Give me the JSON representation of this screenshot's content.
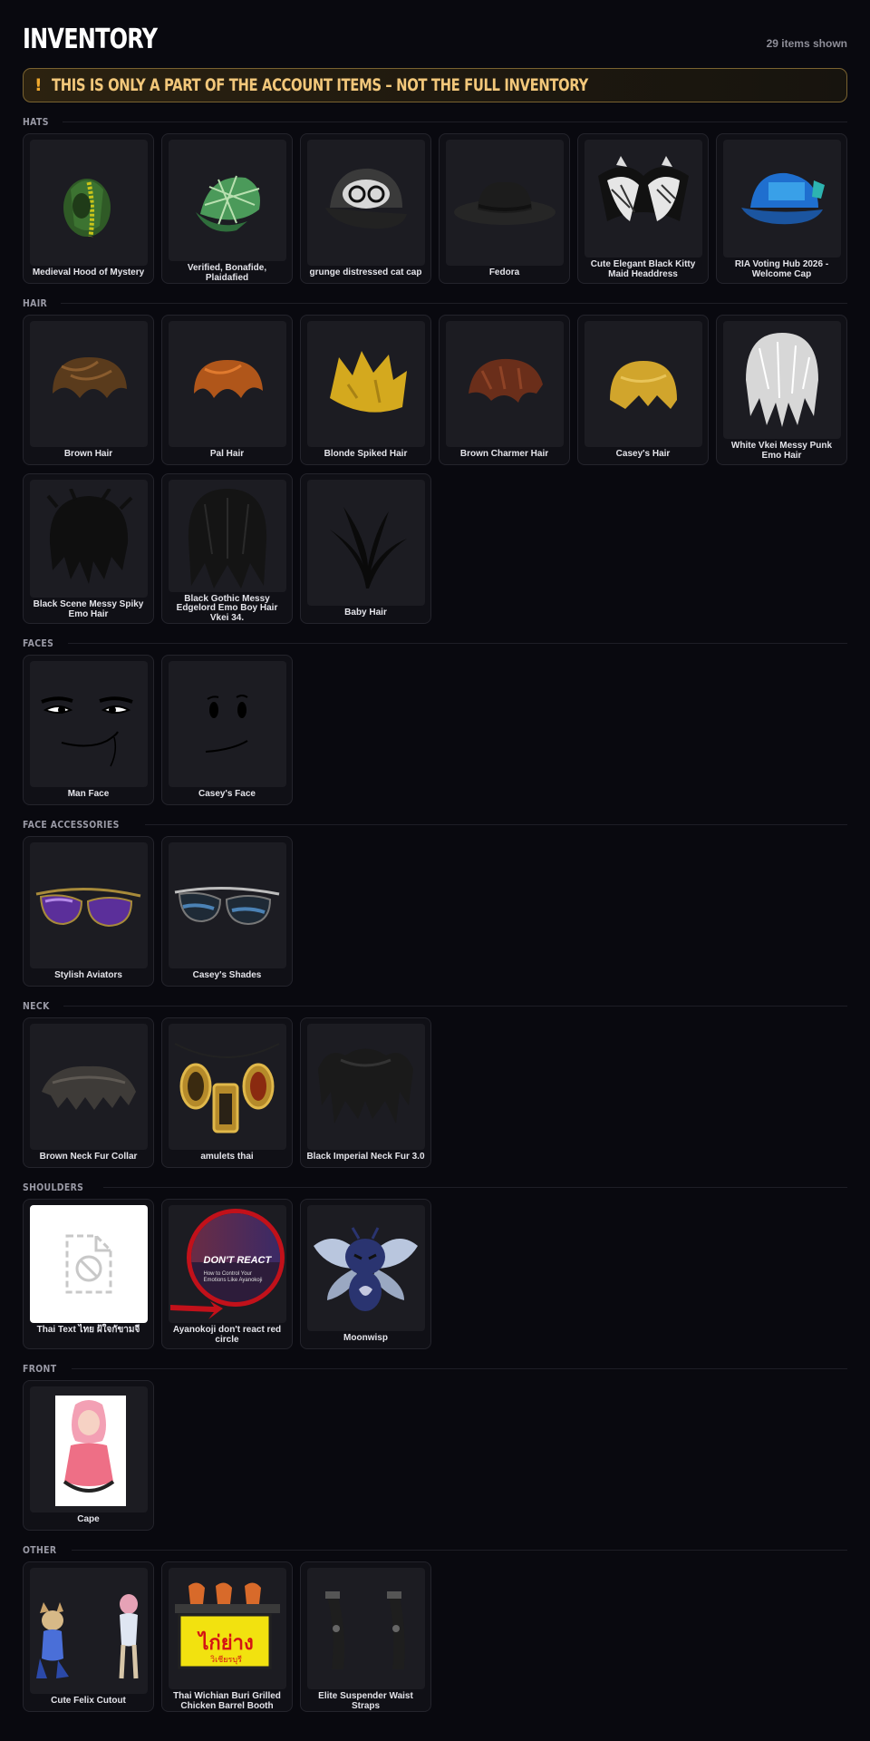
{
  "header": {
    "title": "INVENTORY",
    "count": "29 items shown"
  },
  "banner": {
    "icon": "exclamation",
    "text": "THIS IS ONLY A PART OF THE ACCOUNT ITEMS – NOT THE FULL INVENTORY"
  },
  "sections": {
    "hats": {
      "label": "HATS",
      "items": [
        "Medieval Hood of Mystery",
        "Verified, Bonafide, Plaidafied",
        "grunge distressed cat cap",
        "Fedora",
        "Cute Elegant Black Kitty Maid Headdress",
        "RIA Voting Hub 2026 - Welcome Cap"
      ]
    },
    "hair": {
      "label": "HAIR",
      "items": [
        "Brown Hair",
        "Pal Hair",
        "Blonde Spiked Hair",
        "Brown Charmer Hair",
        "Casey's Hair",
        "White Vkei Messy Punk Emo Hair",
        "Black Scene Messy Spiky Emo Hair",
        "Black Gothic Messy Edgelord Emo Boy Hair Vkei 34.",
        "Baby Hair"
      ]
    },
    "faces": {
      "label": "FACES",
      "items": [
        "Man Face",
        "Casey's Face"
      ]
    },
    "face_accessories": {
      "label": "FACE ACCESSORIES",
      "items": [
        "Stylish Aviators",
        "Casey's Shades"
      ]
    },
    "neck": {
      "label": "NECK",
      "items": [
        "Brown Neck Fur Collar",
        "amulets thai",
        "Black Imperial Neck Fur 3.0"
      ]
    },
    "shoulders": {
      "label": "SHOULDERS",
      "items": [
        "Thai Text ไทย ฝ้ใจกัขามจี",
        "Ayanokoji don't react red circle",
        "Moonwisp"
      ]
    },
    "front": {
      "label": "FRONT",
      "items": [
        "Cape"
      ]
    },
    "other": {
      "label": "OTHER",
      "items": [
        "Cute Felix Cutout",
        "Thai Wichian Buri Grilled Chicken Barrel Booth",
        "Elite Suspender Waist Straps"
      ]
    }
  },
  "thumb_text": {
    "dont_react": "DON'T REACT",
    "dont_react_sub": "How to Control Your Emotions Like Ayanokoji",
    "thai_sign": "ไก่ย่าง",
    "thai_sign_sub": "วิเชียรบุรี"
  },
  "colors": {
    "banner_text": "#f2c77a",
    "banner_border": "#7a6330",
    "background": "#09090f",
    "card": "#101016"
  }
}
